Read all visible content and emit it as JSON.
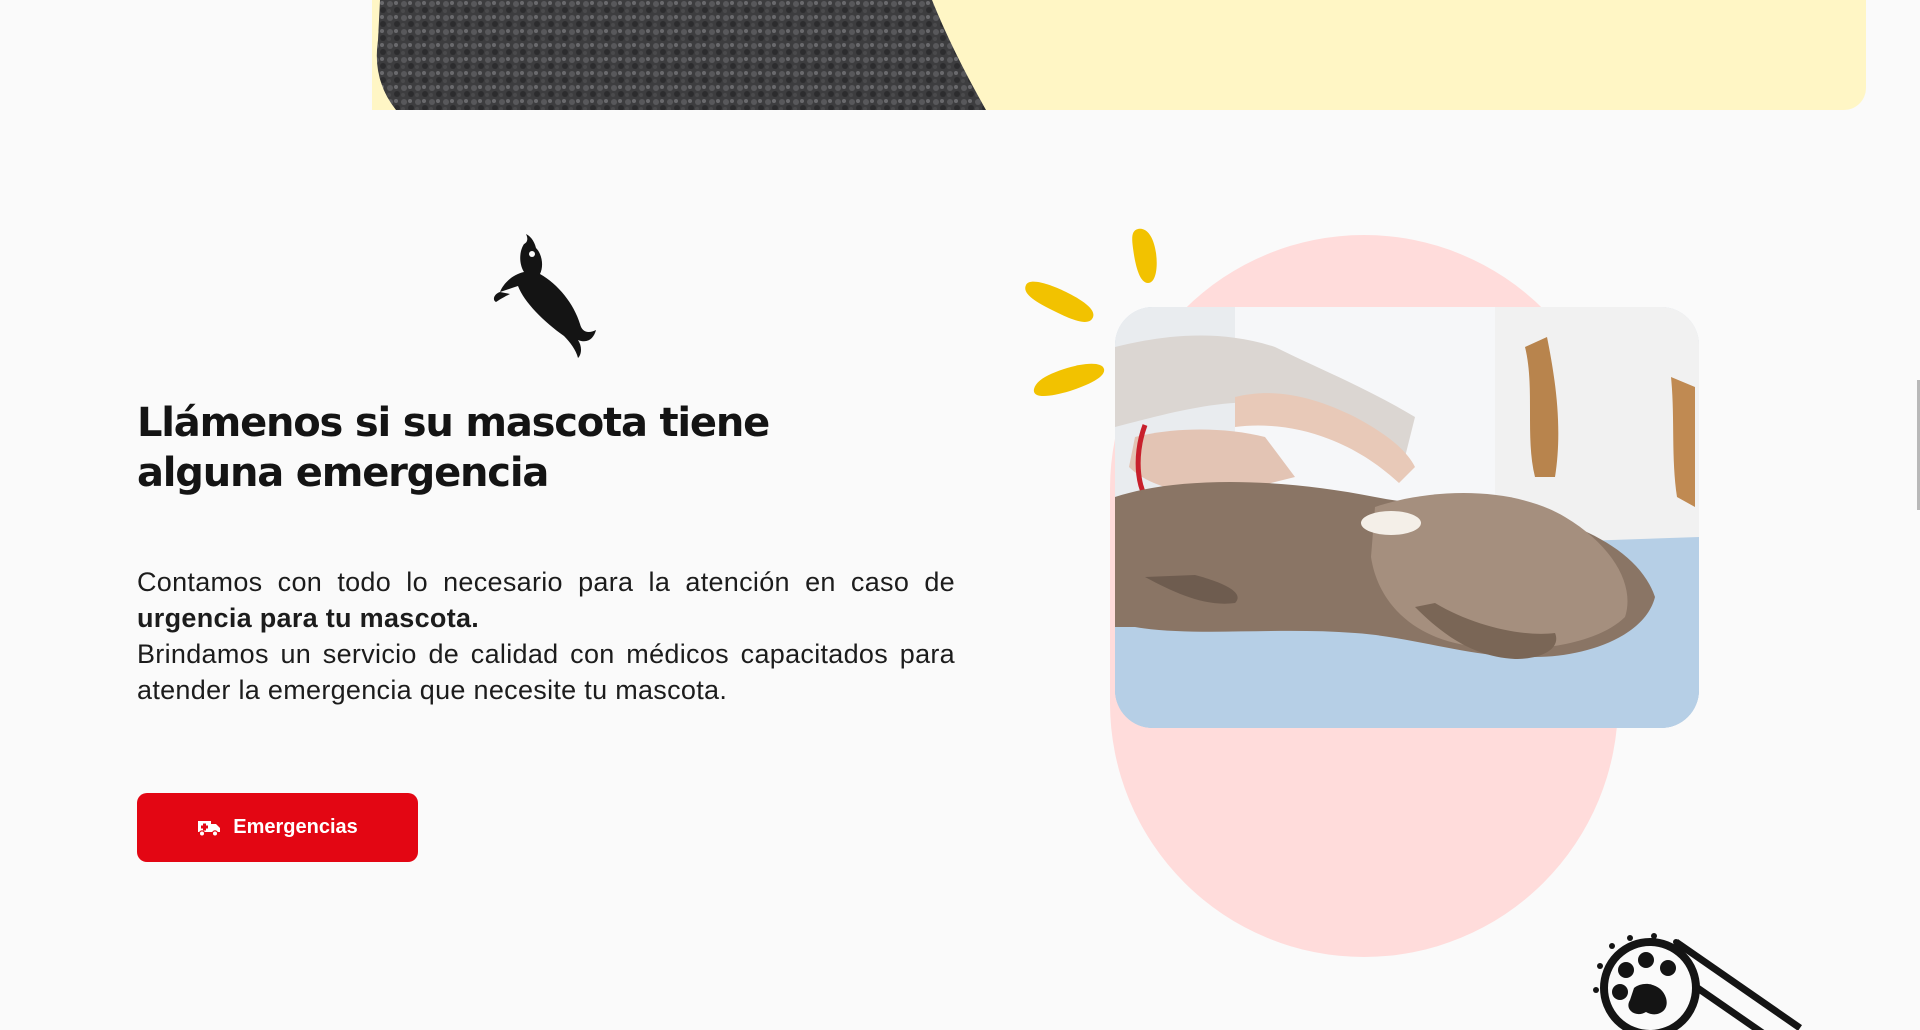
{
  "section": {
    "heading": "Llámenos si su mascota tiene alguna emergencia",
    "description_intro": "Contamos con todo lo necesario para la atención en caso de ",
    "description_bold": "urgencia para tu mascota.",
    "description_rest": "Brindamos un servicio de calidad con médicos capacitados para atender la emergencia que necesite tu mascota.",
    "button_label": "Emergencias",
    "button_icon": "ambulance-icon"
  },
  "decor": {
    "banner_color": "#fff6c5",
    "blob_color": "#ffdcdb",
    "burst_color": "#f2c200",
    "accent_color": "#e30613"
  }
}
